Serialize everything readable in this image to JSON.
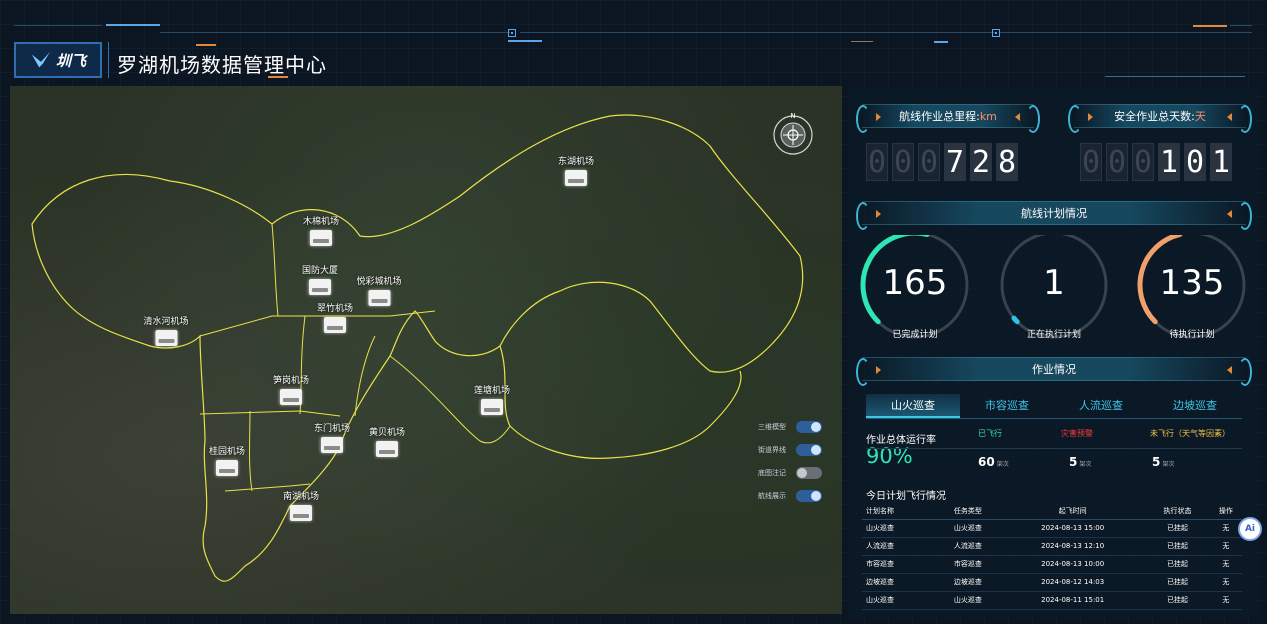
{
  "header": {
    "logo_text": "圳飞",
    "title": "罗湖机场数据管理中心"
  },
  "map": {
    "markers": [
      {
        "label": "东湖机场"
      },
      {
        "label": "木棉机场"
      },
      {
        "label": "国防大厦"
      },
      {
        "label": "悦彩城机场"
      },
      {
        "label": "翠竹机场"
      },
      {
        "label": "清水河机场"
      },
      {
        "label": "笋岗机场"
      },
      {
        "label": "莲塘机场"
      },
      {
        "label": "东门机场"
      },
      {
        "label": "黄贝机场"
      },
      {
        "label": "桂园机场"
      },
      {
        "label": "南湖机场"
      }
    ],
    "compass_label": "N",
    "layers": [
      {
        "label": "三维模型",
        "on": true
      },
      {
        "label": "街道界线",
        "on": true
      },
      {
        "label": "底图注记",
        "on": false
      },
      {
        "label": "航线展示",
        "on": true
      }
    ]
  },
  "mileage": {
    "label": "航线作业总里程:",
    "unit": "km",
    "digits": [
      "0",
      "0",
      "0",
      "7",
      "2",
      "8"
    ],
    "lit_from": 3
  },
  "safe_days": {
    "label": "安全作业总天数:",
    "unit": "天",
    "digits": [
      "0",
      "0",
      "0",
      "1",
      "0",
      "1"
    ],
    "lit_from": 3
  },
  "plan": {
    "header": "航线计划情况",
    "gauges": [
      {
        "value": "165",
        "label": "已完成计划",
        "color": "#2ee6b3",
        "fraction": 0.55
      },
      {
        "value": "1",
        "label": "正在执行计划",
        "color": "#2ec3e6",
        "fraction": 0.02
      },
      {
        "value": "135",
        "label": "待执行计划",
        "color": "#f0a06a",
        "fraction": 0.45
      }
    ]
  },
  "ops": {
    "header": "作业情况",
    "tabs": [
      "山火巡查",
      "市容巡查",
      "人流巡查",
      "边坡巡查"
    ],
    "active_tab": 0,
    "rate_label": "作业总体运行率",
    "rate_value": "90%",
    "stats": [
      {
        "label": "已飞行",
        "value": "60",
        "unit": "架次",
        "color": "#2ee6b3"
      },
      {
        "label": "灾害预警",
        "value": "5",
        "unit": "架次",
        "color": "#ff3b3b"
      },
      {
        "label": "未飞行（天气等因素）",
        "value": "5",
        "unit": "架次",
        "color": "#f0c24a"
      }
    ]
  },
  "schedule": {
    "title": "今日计划飞行情况",
    "columns": [
      "计划名称",
      "任务类型",
      "起飞时间",
      "执行状态",
      "操作"
    ],
    "rows": [
      [
        "山火巡查",
        "山火巡查",
        "2024-08-13 15:00",
        "已挂起",
        "无"
      ],
      [
        "人流巡查",
        "人流巡查",
        "2024-08-13 12:10",
        "已挂起",
        "无"
      ],
      [
        "市容巡查",
        "市容巡查",
        "2024-08-13 10:00",
        "已挂起",
        "无"
      ],
      [
        "边坡巡查",
        "边坡巡查",
        "2024-08-12 14:03",
        "已挂起",
        "无"
      ],
      [
        "山火巡查",
        "山火巡查",
        "2024-08-11 15:01",
        "已挂起",
        "无"
      ]
    ]
  },
  "ai_button": "Ai"
}
